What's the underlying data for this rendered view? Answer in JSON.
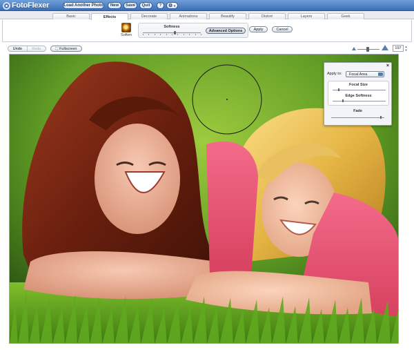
{
  "app": {
    "name": "FotoFlexer",
    "buttons": {
      "load": "Load Another Photo",
      "new": "New",
      "save": "Save",
      "quit": "Quit",
      "help": "?",
      "settings_icon": "gear-icon"
    }
  },
  "tabs": [
    {
      "label": "Basic",
      "active": false
    },
    {
      "label": "Effects",
      "active": true
    },
    {
      "label": "Decorate",
      "active": false
    },
    {
      "label": "Animations",
      "active": false
    },
    {
      "label": "Beautify",
      "active": false
    },
    {
      "label": "Distort",
      "active": false
    },
    {
      "label": "Layers",
      "active": false
    },
    {
      "label": "Geek",
      "active": false
    }
  ],
  "tool": {
    "name": "Soften",
    "icon": "soften-icon",
    "slider_label": "Softness",
    "softness_value": 0.55,
    "advanced_label": "Advanced Options",
    "apply_label": "Apply",
    "cancel_label": "Cancel"
  },
  "toolbar": {
    "undo_label": "Undo",
    "redo_label": "Redo",
    "fullscreen_label": "Fullscreen",
    "zoom_value": "197",
    "zoom_level": 0.45
  },
  "panel": {
    "close_label": "×",
    "apply_to_label": "Apply to:",
    "apply_to_value": "Focal Area",
    "focal_size_label": "Focal Size",
    "focal_size_value": 0.12,
    "edge_softness_label": "Edge Softness",
    "edge_softness_value": 0.2,
    "fade_label": "Fade",
    "fade_value": 0.94
  },
  "colors": {
    "header_blue": "#3b6fb6",
    "grass_green": "#4d8a1f"
  }
}
